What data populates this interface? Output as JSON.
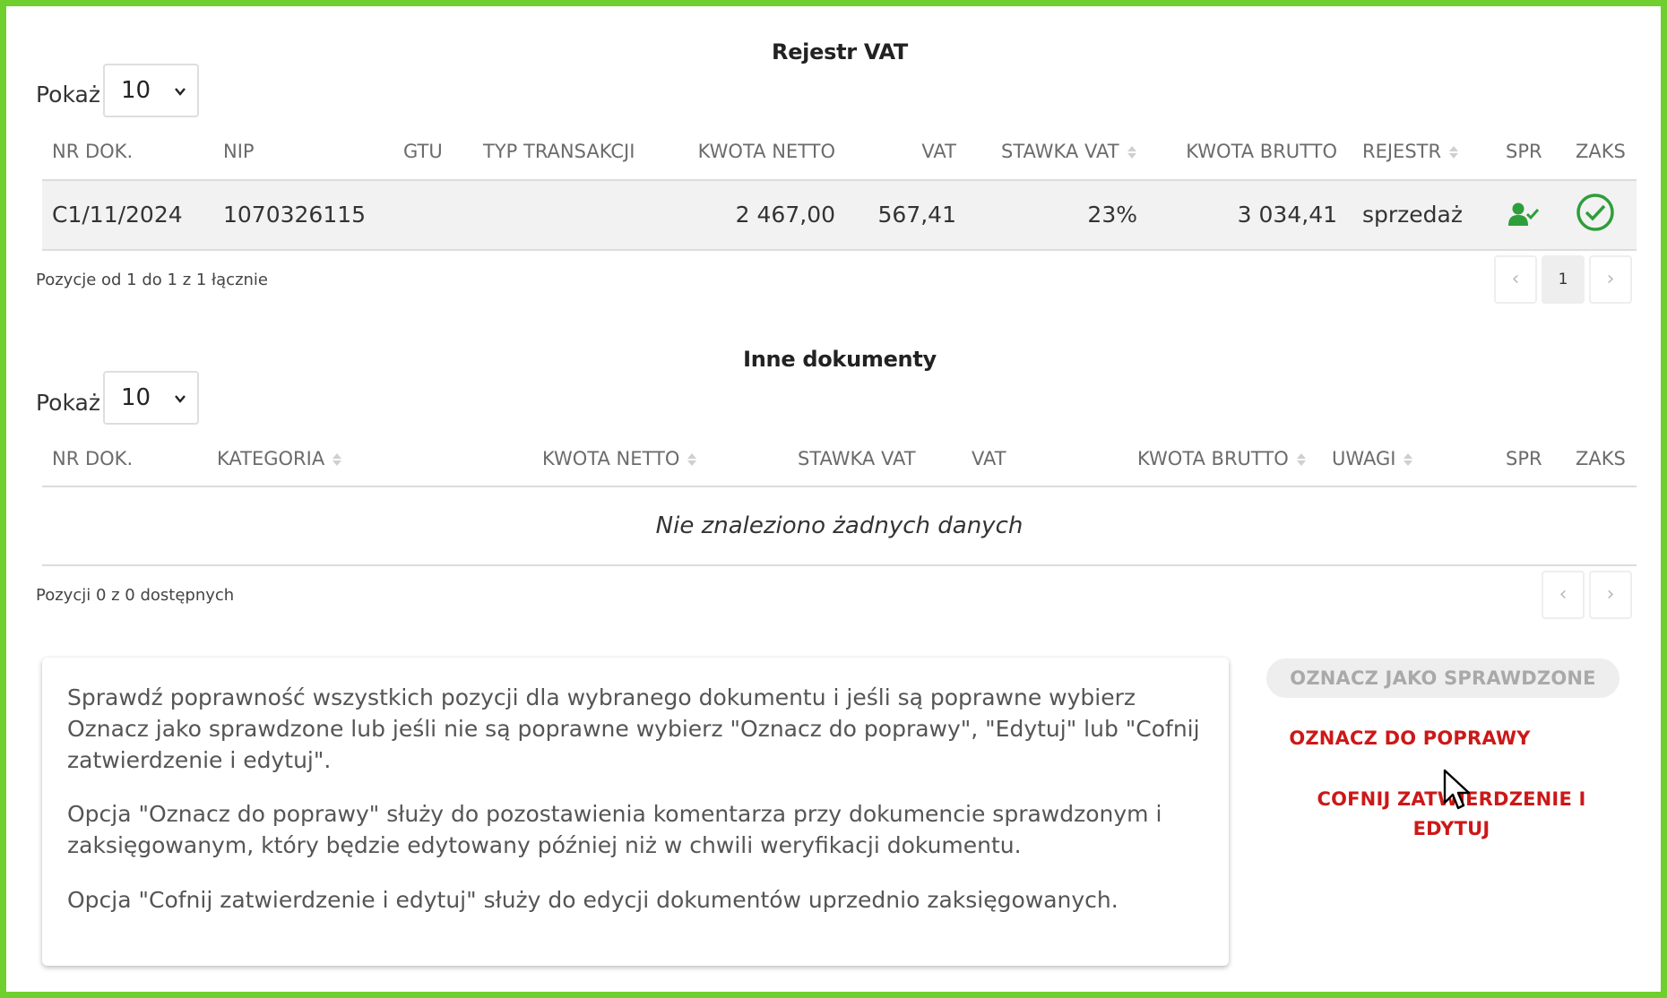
{
  "vat_register": {
    "title": "Rejestr VAT",
    "show_label": "Pokaż",
    "page_size": "10",
    "columns": {
      "nr_dok": "NR DOK.",
      "nip": "NIP",
      "gtu": "GTU",
      "typ_transakcji": "TYP TRANSAKCJI",
      "kwota_netto": "KWOTA NETTO",
      "vat": "VAT",
      "stawka_vat": "STAWKA VAT",
      "kwota_brutto": "KWOTA BRUTTO",
      "rejestr": "REJESTR",
      "spr": "SPR",
      "zaks": "ZAKS"
    },
    "rows": [
      {
        "nr_dok": "C1/11/2024",
        "nip": "1070326115",
        "gtu": "",
        "typ_transakcji": "",
        "kwota_netto": "2 467,00",
        "vat": "567,41",
        "stawka_vat": "23%",
        "kwota_brutto": "3 034,41",
        "rejestr": "sprzedaż",
        "spr_icon": "user-check-icon",
        "zaks_icon": "check-circle-icon"
      }
    ],
    "footer_text": "Pozycje od 1 do 1 z 1 łącznie",
    "pagination": {
      "prev": "‹",
      "current": "1",
      "next": "›"
    }
  },
  "other_documents": {
    "title": "Inne dokumenty",
    "show_label": "Pokaż",
    "page_size": "10",
    "columns": {
      "nr_dok": "NR DOK.",
      "kategoria": "KATEGORIA",
      "kwota_netto": "KWOTA NETTO",
      "stawka_vat": "STAWKA VAT",
      "vat": "VAT",
      "kwota_brutto": "KWOTA BRUTTO",
      "uwagi": "UWAGI",
      "spr": "SPR",
      "zaks": "ZAKS"
    },
    "empty_message": "Nie znaleziono żadnych danych",
    "footer_text": "Pozycji 0 z 0 dostępnych",
    "pagination": {
      "prev": "‹",
      "next": "›"
    }
  },
  "info": {
    "paragraphs": [
      "Sprawdź poprawność wszystkich pozycji dla wybranego dokumentu i jeśli są poprawne wybierz Oznacz jako sprawdzone lub jeśli nie są poprawne wybierz \"Oznacz do poprawy\", \"Edytuj\" lub \"Cofnij zatwierdzenie i edytuj\".",
      "Opcja \"Oznacz do poprawy\" służy do pozostawienia komentarza przy dokumencie sprawdzonym i zaksięgowanym, który będzie edytowany później niż w chwili weryfikacji dokumentu.",
      "Opcja \"Cofnij zatwierdzenie i edytuj\" służy do edycji dokumentów uprzednio zaksięgowanych."
    ]
  },
  "actions": {
    "mark_checked": "OZNACZ JAKO SPRAWDZONE",
    "mark_for_correction": "OZNACZ DO POPRAWY",
    "undo_approval_line1": "COFNIJ ZATWIERDZENIE I",
    "undo_approval_line2": "EDYTUJ"
  },
  "colors": {
    "frame_border": "#6fcf2f",
    "accent_green": "#2e9e3a",
    "danger_red": "#cc1818",
    "disabled_grey": "#a9a9a9"
  }
}
